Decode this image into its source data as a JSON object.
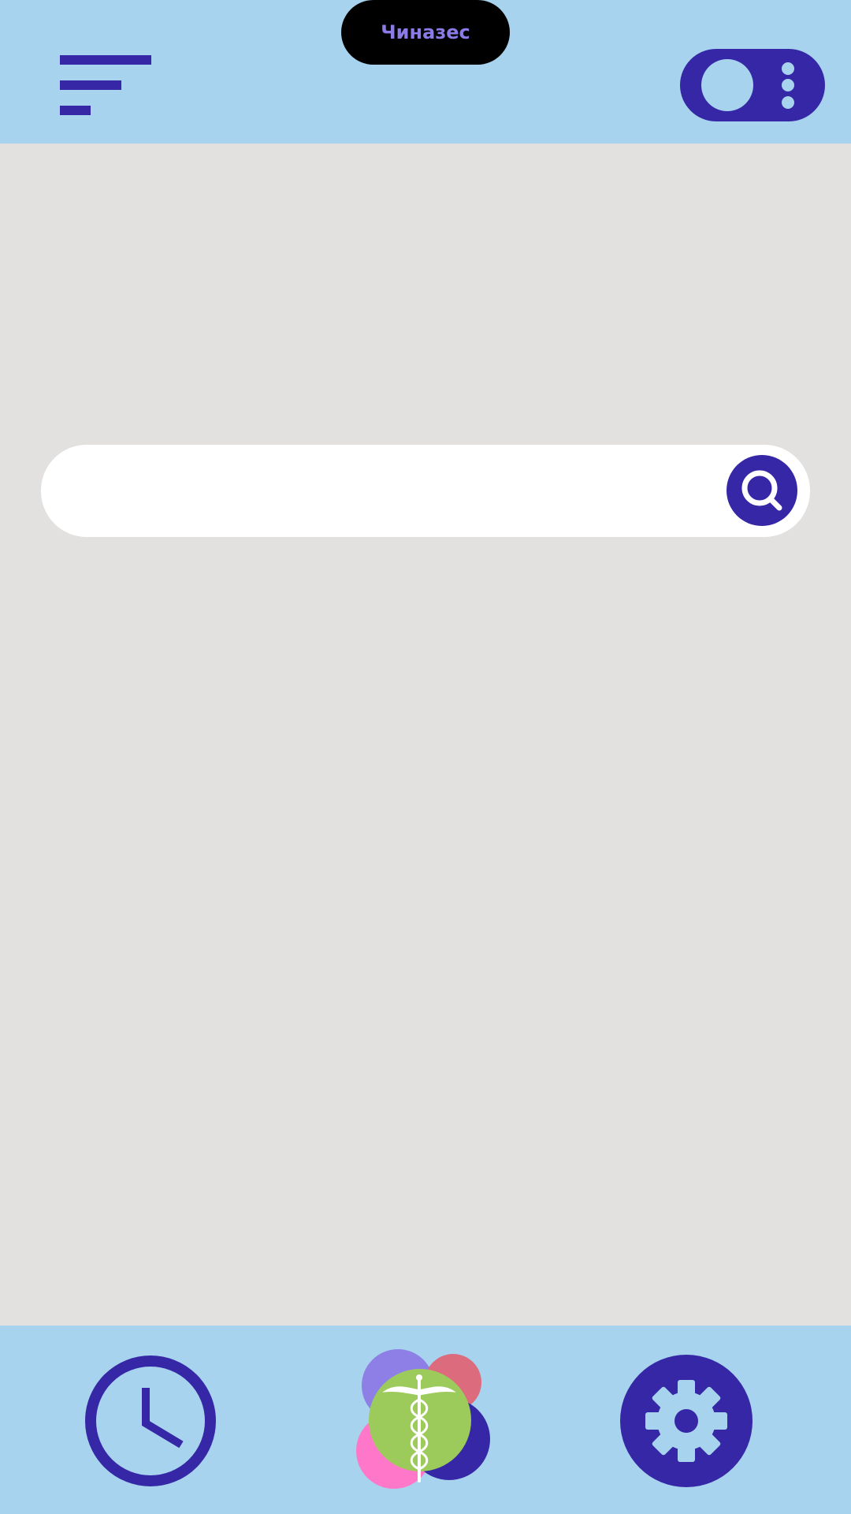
{
  "header": {
    "title": "Чиназес",
    "menu_icon": "menu-icon",
    "toggle_icon": "toggle-more-icon"
  },
  "search": {
    "value": "",
    "placeholder": "",
    "button_icon": "search-icon"
  },
  "bottom_nav": {
    "items": [
      {
        "icon": "clock-icon"
      },
      {
        "icon": "caduceus-icon"
      },
      {
        "icon": "gear-icon"
      }
    ]
  },
  "colors": {
    "bar_background": "#a7d3ee",
    "page_background": "#e3e0e0",
    "accent": "#3527a6",
    "title_text": "#8a7be6",
    "title_pill": "#000000",
    "home_green": "#9ccb5b",
    "home_pink": "#ff77c8",
    "home_purple": "#8d7fe6",
    "home_red": "#dc6b7e"
  }
}
